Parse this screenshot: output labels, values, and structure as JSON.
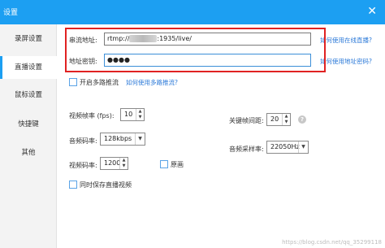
{
  "window": {
    "title": "设置",
    "close_glyph": "✕"
  },
  "sidebar": {
    "items": [
      {
        "label": "录屏设置"
      },
      {
        "label": "直播设置"
      },
      {
        "label": "鼠标设置"
      },
      {
        "label": "快捷键"
      },
      {
        "label": "其他"
      }
    ],
    "active_index": 1
  },
  "stream": {
    "url_label": "串流地址:",
    "url_prefix": "rtmp://",
    "url_suffix": ":1935/live/",
    "url_link": "如何使用在线直播?",
    "key_label": "地址密钥:",
    "key_value": "●●●●",
    "key_link": "如何使用地址密码?",
    "multi_label": "开启多路推流",
    "multi_link": "如何使用多路推流?"
  },
  "video": {
    "fps_label": "视频帧率 (fps):",
    "fps_value": "10",
    "keyframe_label": "关键帧间距:",
    "keyframe_value": "20",
    "audio_bitrate_label": "音频码率:",
    "audio_bitrate_value": "128kbps",
    "sample_rate_label": "音频采样率:",
    "sample_rate_value": "22050Hz",
    "video_bitrate_label": "视频码率:",
    "video_bitrate_value": "1200",
    "original_label": "原画",
    "save_label": "同时保存直播视频"
  },
  "watermark": "https://blog.csdn.net/qq_35299118"
}
